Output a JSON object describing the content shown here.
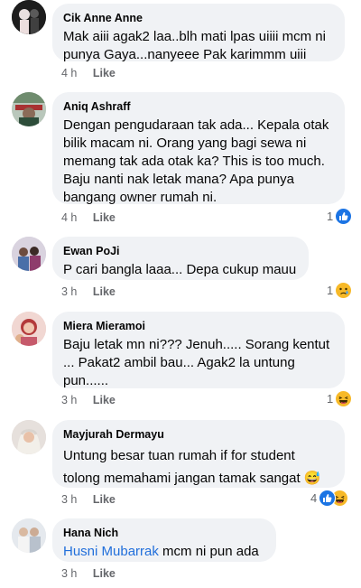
{
  "comments": [
    {
      "author": "Cik Anne Anne",
      "text": "Mak aiii agak2 laa..blh mati lpas uiiii mcm ni punya Gaya...nanyeee Pak karimmm uiii",
      "time": "4 h",
      "like_label": "Like",
      "reaction_count": "",
      "reactions": []
    },
    {
      "author": "Aniq Ashraff",
      "text": "Dengan pengudaraan tak ada... Kepala otak bilik macam ni. Orang yang bagi sewa ni memang tak ada otak ka? This is too much. Baju nanti nak letak mana? Apa punya bangang owner rumah ni.",
      "time": "4 h",
      "like_label": "Like",
      "reaction_count": "1",
      "reactions": [
        "like"
      ]
    },
    {
      "author": "Ewan PoJi",
      "text": "P cari bangla laaa... Depa cukup mauu",
      "time": "3 h",
      "like_label": "Like",
      "reaction_count": "1",
      "reactions": [
        "sad"
      ]
    },
    {
      "author": "Miera Mieramoi",
      "text": "Baju letak mn ni??? Jenuh..... Sorang kentut ... Pakat2 ambil bau... Agak2 la untung pun......",
      "time": "3 h",
      "like_label": "Like",
      "reaction_count": "1",
      "reactions": [
        "haha"
      ]
    },
    {
      "author": "Mayjurah Dermayu",
      "text": "Untung besar tuan rumah if for student tolong memahami jangan tamak sangat 😅",
      "time": "3 h",
      "like_label": "Like",
      "reaction_count": "4",
      "reactions": [
        "like",
        "haha"
      ]
    },
    {
      "author": "Hana Nich",
      "mention": "Husni Mubarrak",
      "text": "mcm ni pun ada",
      "time": "3 h",
      "like_label": "Like",
      "reaction_count": "",
      "reactions": []
    }
  ],
  "colors": {
    "like_blue": "#1b74e4",
    "emoji_yellow": "#f7b928",
    "bubble_bg": "#f0f2f5",
    "meta_gray": "#65676b",
    "mention_blue": "#216fdb"
  }
}
